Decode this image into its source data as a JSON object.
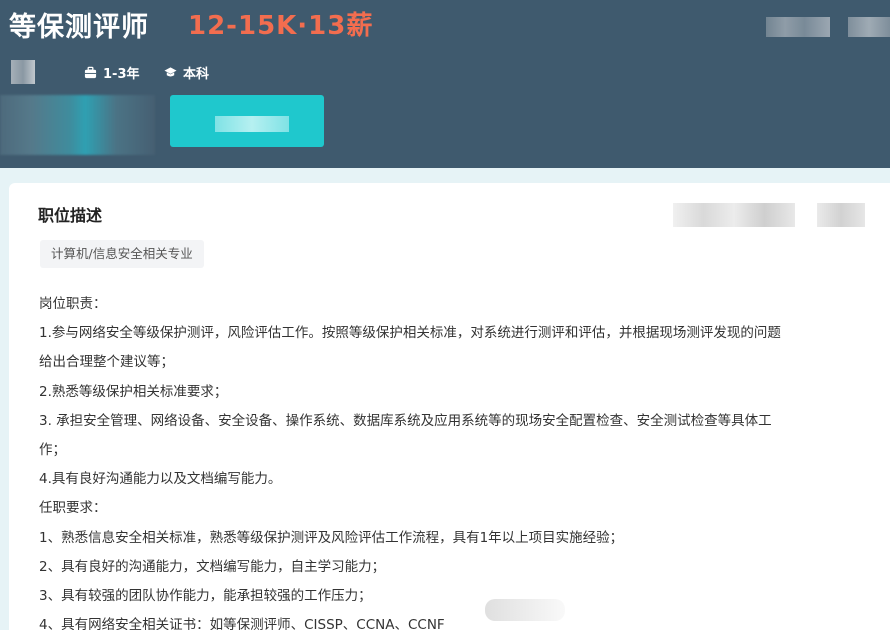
{
  "header": {
    "job_title": "等保测评师",
    "salary": "12-15K·13薪",
    "experience": "1-3年",
    "education": "本科"
  },
  "card": {
    "section_title": "职位描述",
    "tag": "计算机/信息安全相关专业",
    "description_lines": [
      "岗位职责：",
      "1.参与网络安全等级保护测评，风险评估工作。按照等级保护相关标准，对系统进行测评和评估，并根据现场测评发现的问题",
      "给出合理整个建议等；",
      "2.熟悉等级保护相关标准要求；",
      "3. 承担安全管理、网络设备、安全设备、操作系统、数据库系统及应用系统等的现场安全配置检查、安全测试检查等具体工",
      "作；",
      "4.具有良好沟通能力以及文档编写能力。",
      "任职要求：",
      "1、熟悉信息安全相关标准，熟悉等级保护测评及风险评估工作流程，具有1年以上项目实施经验；",
      "2、具有良好的沟通能力，文档编写能力，自主学习能力；",
      "3、具有较强的团队协作能力，能承担较强的工作压力；",
      "4、具有网络安全相关证书：如等保测评师、CISSP、CCNA、CCNF"
    ]
  },
  "icons": {
    "experience": "briefcase-icon",
    "education": "graduation-cap-icon"
  },
  "colors": {
    "header_bg": "#3f5a6e",
    "salary": "#f26d4f",
    "accent_button": "#1fc8cd",
    "page_bg": "#e6f3f6"
  }
}
